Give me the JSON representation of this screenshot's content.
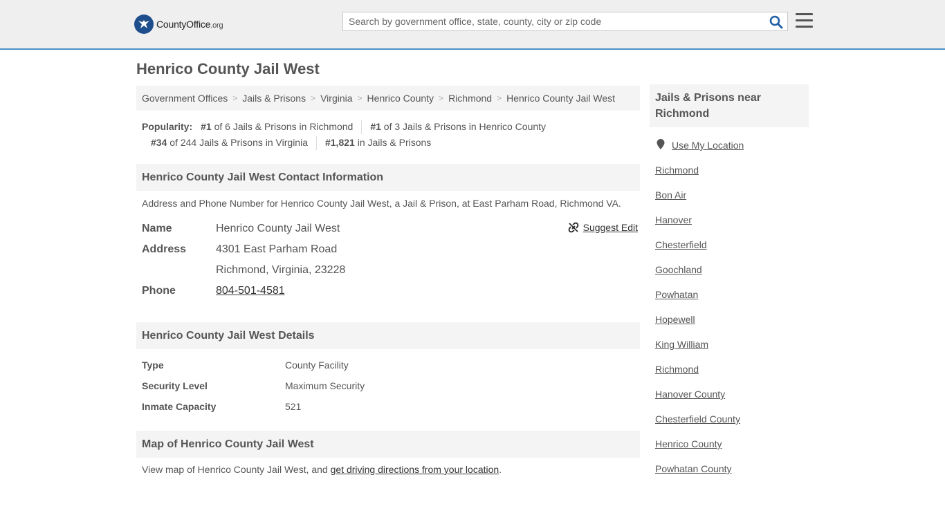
{
  "header": {
    "logo_main": "CountyOffice",
    "logo_tld": ".org",
    "search_placeholder": "Search by government office, state, county, city or zip code"
  },
  "page_title": "Henrico County Jail West",
  "breadcrumb": [
    "Government Offices",
    "Jails & Prisons",
    "Virginia",
    "Henrico County",
    "Richmond",
    "Henrico County Jail West"
  ],
  "popularity": {
    "label": "Popularity:",
    "items": [
      {
        "rank": "#1",
        "text": " of 6 Jails & Prisons in Richmond"
      },
      {
        "rank": "#1",
        "text": " of 3 Jails & Prisons in Henrico County"
      },
      {
        "rank": "#34",
        "text": " of 244 Jails & Prisons in Virginia"
      },
      {
        "rank": "#1,821",
        "text": " in Jails & Prisons"
      }
    ]
  },
  "contact": {
    "heading": "Henrico County Jail West Contact Information",
    "description": "Address and Phone Number for Henrico County Jail West, a Jail & Prison, at East Parham Road, Richmond VA.",
    "suggest_edit": "Suggest Edit",
    "name_label": "Name",
    "name_value": "Henrico County Jail West",
    "address_label": "Address",
    "address_line1": "4301 East Parham Road",
    "address_line2": "Richmond, Virginia, 23228",
    "phone_label": "Phone",
    "phone_value": "804-501-4581"
  },
  "details": {
    "heading": "Henrico County Jail West Details",
    "rows": [
      {
        "label": "Type",
        "value": "County Facility"
      },
      {
        "label": "Security Level",
        "value": "Maximum Security"
      },
      {
        "label": "Inmate Capacity",
        "value": "521"
      }
    ]
  },
  "map": {
    "heading": "Map of Henrico County Jail West",
    "desc_prefix": "View map of Henrico County Jail West, and ",
    "desc_link": "get driving directions from your location",
    "desc_suffix": "."
  },
  "sidebar": {
    "heading": "Jails & Prisons near Richmond",
    "use_location": "Use My Location",
    "links": [
      "Richmond",
      "Bon Air",
      "Hanover",
      "Chesterfield",
      "Goochland",
      "Powhatan",
      "Hopewell",
      "King William",
      "Richmond",
      "Hanover County",
      "Chesterfield County",
      "Henrico County",
      "Powhatan County"
    ]
  },
  "colors": {
    "brand_blue": "#1f4e8c",
    "accent_line": "#4a8fc9",
    "panel_bg": "#f4f4f4"
  }
}
